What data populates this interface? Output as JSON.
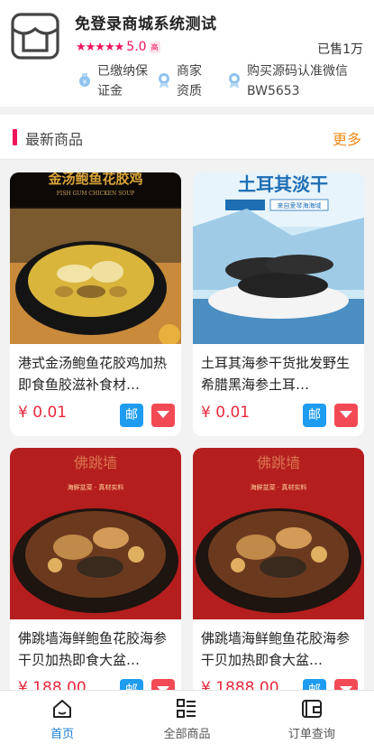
{
  "shop": {
    "name": "免登录商城系统测试",
    "stars": "★★★★★",
    "rating": "5.0",
    "level": "高",
    "sold": "已售1万",
    "badges": [
      {
        "icon": "deposit-badge-icon",
        "text": "已缴纳保证金"
      },
      {
        "icon": "qualification-badge-icon",
        "text": "商家资质"
      },
      {
        "icon": "wechat-badge-icon",
        "text": "购买源码认准微信BW5653"
      }
    ]
  },
  "section": {
    "title": "最新商品",
    "more": "更多"
  },
  "products": [
    {
      "title": "港式金汤鲍鱼花胶鸡加热即食鱼胶滋补食材…",
      "price": "¥ 0.01",
      "mail_label": "邮",
      "image_text": "金汤鲍鱼花胶鸡",
      "image_subtext": "FISH GUM CHICKEN SOUP"
    },
    {
      "title": "土耳其海参干货批发野生希腊黑海参土耳…",
      "price": "¥ 0.01",
      "mail_label": "邮",
      "image_text": "土耳其淡干",
      "image_subtext": "来自爱琴海海域"
    },
    {
      "title": "佛跳墙海鲜鲍鱼花胶海参干贝加热即食大盆…",
      "price": "¥ 188.00",
      "mail_label": "邮",
      "image_text": "佛跳墙",
      "image_subtext": "海鲜盆菜 · 真材实料"
    },
    {
      "title": "佛跳墙海鲜鲍鱼花胶海参干贝加热即食大盆…",
      "price": "¥ 1888.00",
      "mail_label": "邮",
      "image_text": "佛跳墙",
      "image_subtext": "海鲜盆菜 · 真材实料"
    }
  ],
  "tabbar": [
    {
      "label": "首页",
      "icon": "home-icon",
      "active": true
    },
    {
      "label": "全部商品",
      "icon": "list-icon",
      "active": false
    },
    {
      "label": "订单查询",
      "icon": "order-icon",
      "active": false
    }
  ],
  "colors": {
    "accent": "#f0145a",
    "more": "#f08c1e",
    "price": "#e8283c",
    "mail": "#1e9cf0",
    "cart": "#f24a55",
    "tab_active": "#1a7fd4"
  }
}
